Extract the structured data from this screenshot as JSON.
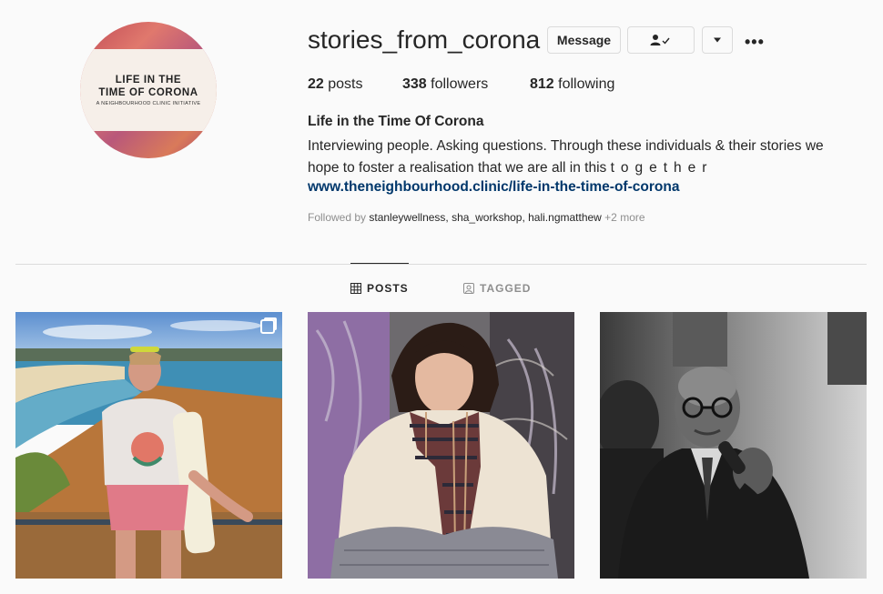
{
  "profile": {
    "username": "stories_from_corona",
    "avatar_line1": "LIFE IN THE",
    "avatar_line2": "TIME OF CORONA",
    "avatar_line3": "A NEIGHBOURHOOD CLINIC INITIATIVE",
    "posts_count": "22",
    "posts_label": " posts",
    "followers_count": "338",
    "followers_label": " followers",
    "following_count": "812",
    "following_label": " following",
    "full_name": "Life in the Time Of Corona",
    "bio_line1": "Interviewing people. Asking questions. Through these individuals & their stories we",
    "bio_line2_start": "hope to foster a realisation that we are all in this ",
    "bio_line2_spaced": "together",
    "website": "www.theneighbourhood.clinic/life-in-the-time-of-corona",
    "followed_by_prefix": "Followed by ",
    "followed_by_users": "stanleywellness, sha_workshop, hali.ngmatthew",
    "followed_by_more": " +2 more"
  },
  "actions": {
    "message_label": "Message",
    "dropdown_icon": "caret-down-icon",
    "following_icon": "person-check-icon",
    "more_icon": "more-options-icon",
    "more_label": "•••"
  },
  "tabs": {
    "posts_label": "POSTS",
    "tagged_label": "TAGGED"
  },
  "posts": [
    {
      "description_icon": "multi-photo-icon"
    },
    {},
    {}
  ],
  "colors": {
    "link": "#00376b",
    "border": "#dbdbdb",
    "muted": "#8e8e8e",
    "background": "#fafafa"
  }
}
